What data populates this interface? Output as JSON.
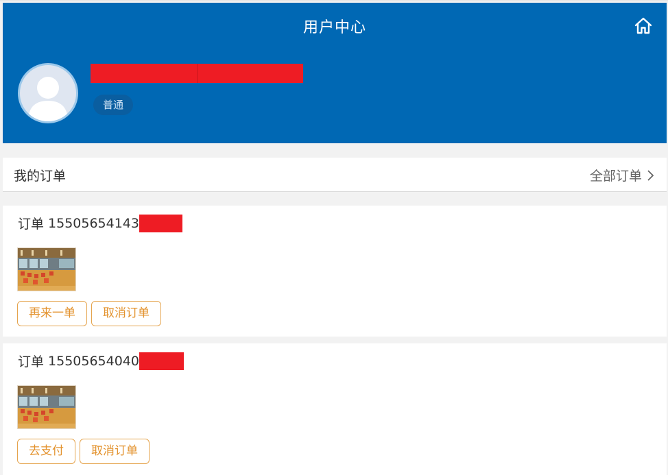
{
  "header": {
    "title": "用户中心",
    "level": "普通"
  },
  "orders_section": {
    "title": "我的订单",
    "all_link": "全部订单"
  },
  "orders": [
    {
      "prefix": "订单",
      "number": "15505654143",
      "buttons": [
        "再来一单",
        "取消订单"
      ]
    },
    {
      "prefix": "订单",
      "number": "15505654040",
      "buttons": [
        "去支付",
        "取消订单"
      ]
    }
  ],
  "colors": {
    "header_bg": "#0068b4",
    "accent": "#e3922d",
    "redaction": "#ee1c24"
  }
}
